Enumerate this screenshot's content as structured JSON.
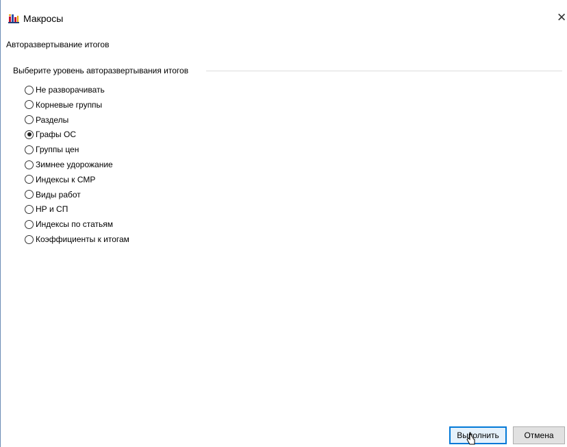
{
  "window": {
    "title": "Макросы",
    "app_icon": "bar-chart-icon",
    "close_glyph": "✕"
  },
  "subtitle": "Авторазвертывание итогов",
  "group": {
    "label": "Выберите уровень авторазвертывания итогов",
    "selected_index": 3,
    "options": [
      {
        "label": "Не разворачивать",
        "checked": false
      },
      {
        "label": "Корневые группы",
        "checked": false
      },
      {
        "label": "Разделы",
        "checked": false
      },
      {
        "label": "Графы ОС",
        "checked": true
      },
      {
        "label": "Группы цен",
        "checked": false
      },
      {
        "label": "Зимнее удорожание",
        "checked": false
      },
      {
        "label": "Индексы к СМР",
        "checked": false
      },
      {
        "label": "Виды работ",
        "checked": false
      },
      {
        "label": "НР и СП",
        "checked": false
      },
      {
        "label": "Индексы по статьям",
        "checked": false
      },
      {
        "label": "Коэффициенты к итогам",
        "checked": false
      }
    ]
  },
  "buttons": {
    "execute_label": "Выполнить",
    "cancel_label": "Отмена"
  },
  "colors": {
    "accent": "#0078d7",
    "button_bg": "#e1e1e1"
  }
}
